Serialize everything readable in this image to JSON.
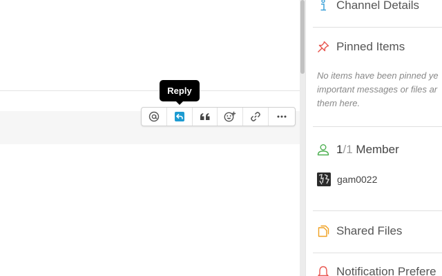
{
  "tooltip": {
    "text": "Reply"
  },
  "toolbar": {
    "buttons": [
      {
        "name": "mention",
        "icon": "at-icon"
      },
      {
        "name": "reply",
        "icon": "reply-icon",
        "color": "#1d9bd1"
      },
      {
        "name": "quote",
        "icon": "quote-icon"
      },
      {
        "name": "react",
        "icon": "add-reaction-icon"
      },
      {
        "name": "copy-link",
        "icon": "link-icon"
      },
      {
        "name": "more",
        "icon": "more-horizontal-icon"
      }
    ]
  },
  "sidebar": {
    "channel_details": {
      "title": "Channel Details",
      "icon": "info-icon",
      "color": "#3aa0d8"
    },
    "pinned": {
      "title": "Pinned Items",
      "icon": "pin-icon",
      "color": "#e8564f",
      "empty_lines": [
        "No items have been pinned ye",
        "important messages or files ar",
        "them here."
      ]
    },
    "members": {
      "current": "1",
      "separator": "/",
      "total": "1",
      "label": "Member",
      "icon": "person-icon",
      "color": "#4caf50",
      "list": [
        {
          "name": "gam0022"
        }
      ]
    },
    "shared_files": {
      "title": "Shared Files",
      "icon": "file-icon",
      "color": "#f0a020"
    },
    "notifications": {
      "title": "Notification Prefere",
      "icon": "bell-icon",
      "color": "#e8564f"
    }
  }
}
